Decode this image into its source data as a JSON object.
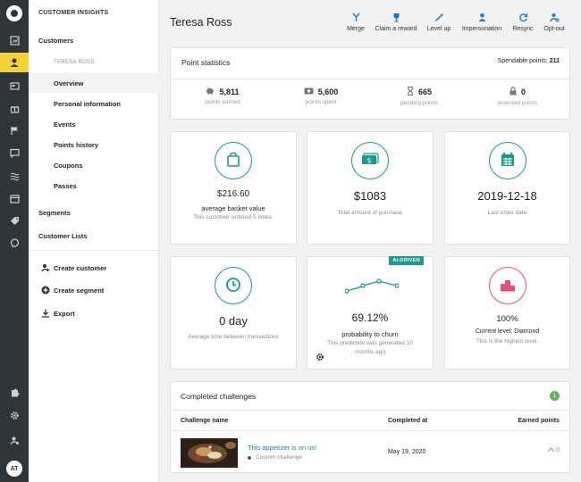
{
  "sidebar": {
    "section_title": "CUSTOMER INSIGHTS",
    "customers_label": "Customers",
    "customer_name_label": "TERESA ROSS",
    "items": [
      "Overview",
      "Personal information",
      "Events",
      "Points history",
      "Coupons",
      "Passes"
    ],
    "segments_label": "Segments",
    "customer_lists_label": "Customer Lists",
    "actions": [
      "Create customer",
      "Create segment",
      "Export"
    ]
  },
  "rail": {
    "icons": [
      "dashboard-icon",
      "customers-icon",
      "campaigns-icon",
      "rewards-icon",
      "flag-icon",
      "messages-icon",
      "waves-icon",
      "calendar-icon",
      "tag-icon",
      "chat-icon",
      "puzzle-icon",
      "gear-icon",
      "user-settings-icon"
    ],
    "avatar_initials": "AT"
  },
  "header": {
    "title": "Teresa Ross",
    "actions": [
      "Merge",
      "Claim a reward",
      "Level up",
      "Impersonation",
      "Resync",
      "Opt-out"
    ]
  },
  "point_statistics": {
    "title": "Point statistics",
    "spendable_label": "Spendable points:",
    "spendable_value": "211",
    "stats": [
      {
        "value": "5,811",
        "label": "points earned",
        "icon": "piggy-icon"
      },
      {
        "value": "5,600",
        "label": "points spent",
        "icon": "wallet-icon"
      },
      {
        "value": "665",
        "label": "pending points",
        "icon": "hourglass-icon"
      },
      {
        "value": "0",
        "label": "reserved points",
        "icon": "lock-icon"
      }
    ]
  },
  "kpis": {
    "basket": {
      "value": "$216.60",
      "label": "average basket value",
      "note": "This customer ordered 5 times."
    },
    "purchase": {
      "value": "$1083",
      "label": "Total amount of purchase"
    },
    "last_order": {
      "value": "2019-12-18",
      "label": "Last order date"
    },
    "time_between": {
      "value": "0 day",
      "label": "Average time between transactions"
    },
    "churn": {
      "badge": "AI-DRIVEN",
      "value": "69.12%",
      "label": "probability to churn",
      "note": "This prediction was generated 10 months ago"
    },
    "level": {
      "value": "100%",
      "label": "Current level: Diamond",
      "note": "This is the highest level."
    }
  },
  "challenges": {
    "title": "Completed challenges",
    "count": "1",
    "columns": [
      "Challenge name",
      "Completed at",
      "Earned points"
    ],
    "rows": [
      {
        "name": "This appetizer is on us!",
        "type": "Custom challenge",
        "completed_at": "May 19, 2020",
        "points": "0"
      }
    ]
  },
  "colors": {
    "accent": "#1a9a91",
    "active": "#f2d236",
    "rail": "#2d3538",
    "pink": "#e2507a",
    "link": "#1979c3",
    "success": "#5cb85c"
  }
}
